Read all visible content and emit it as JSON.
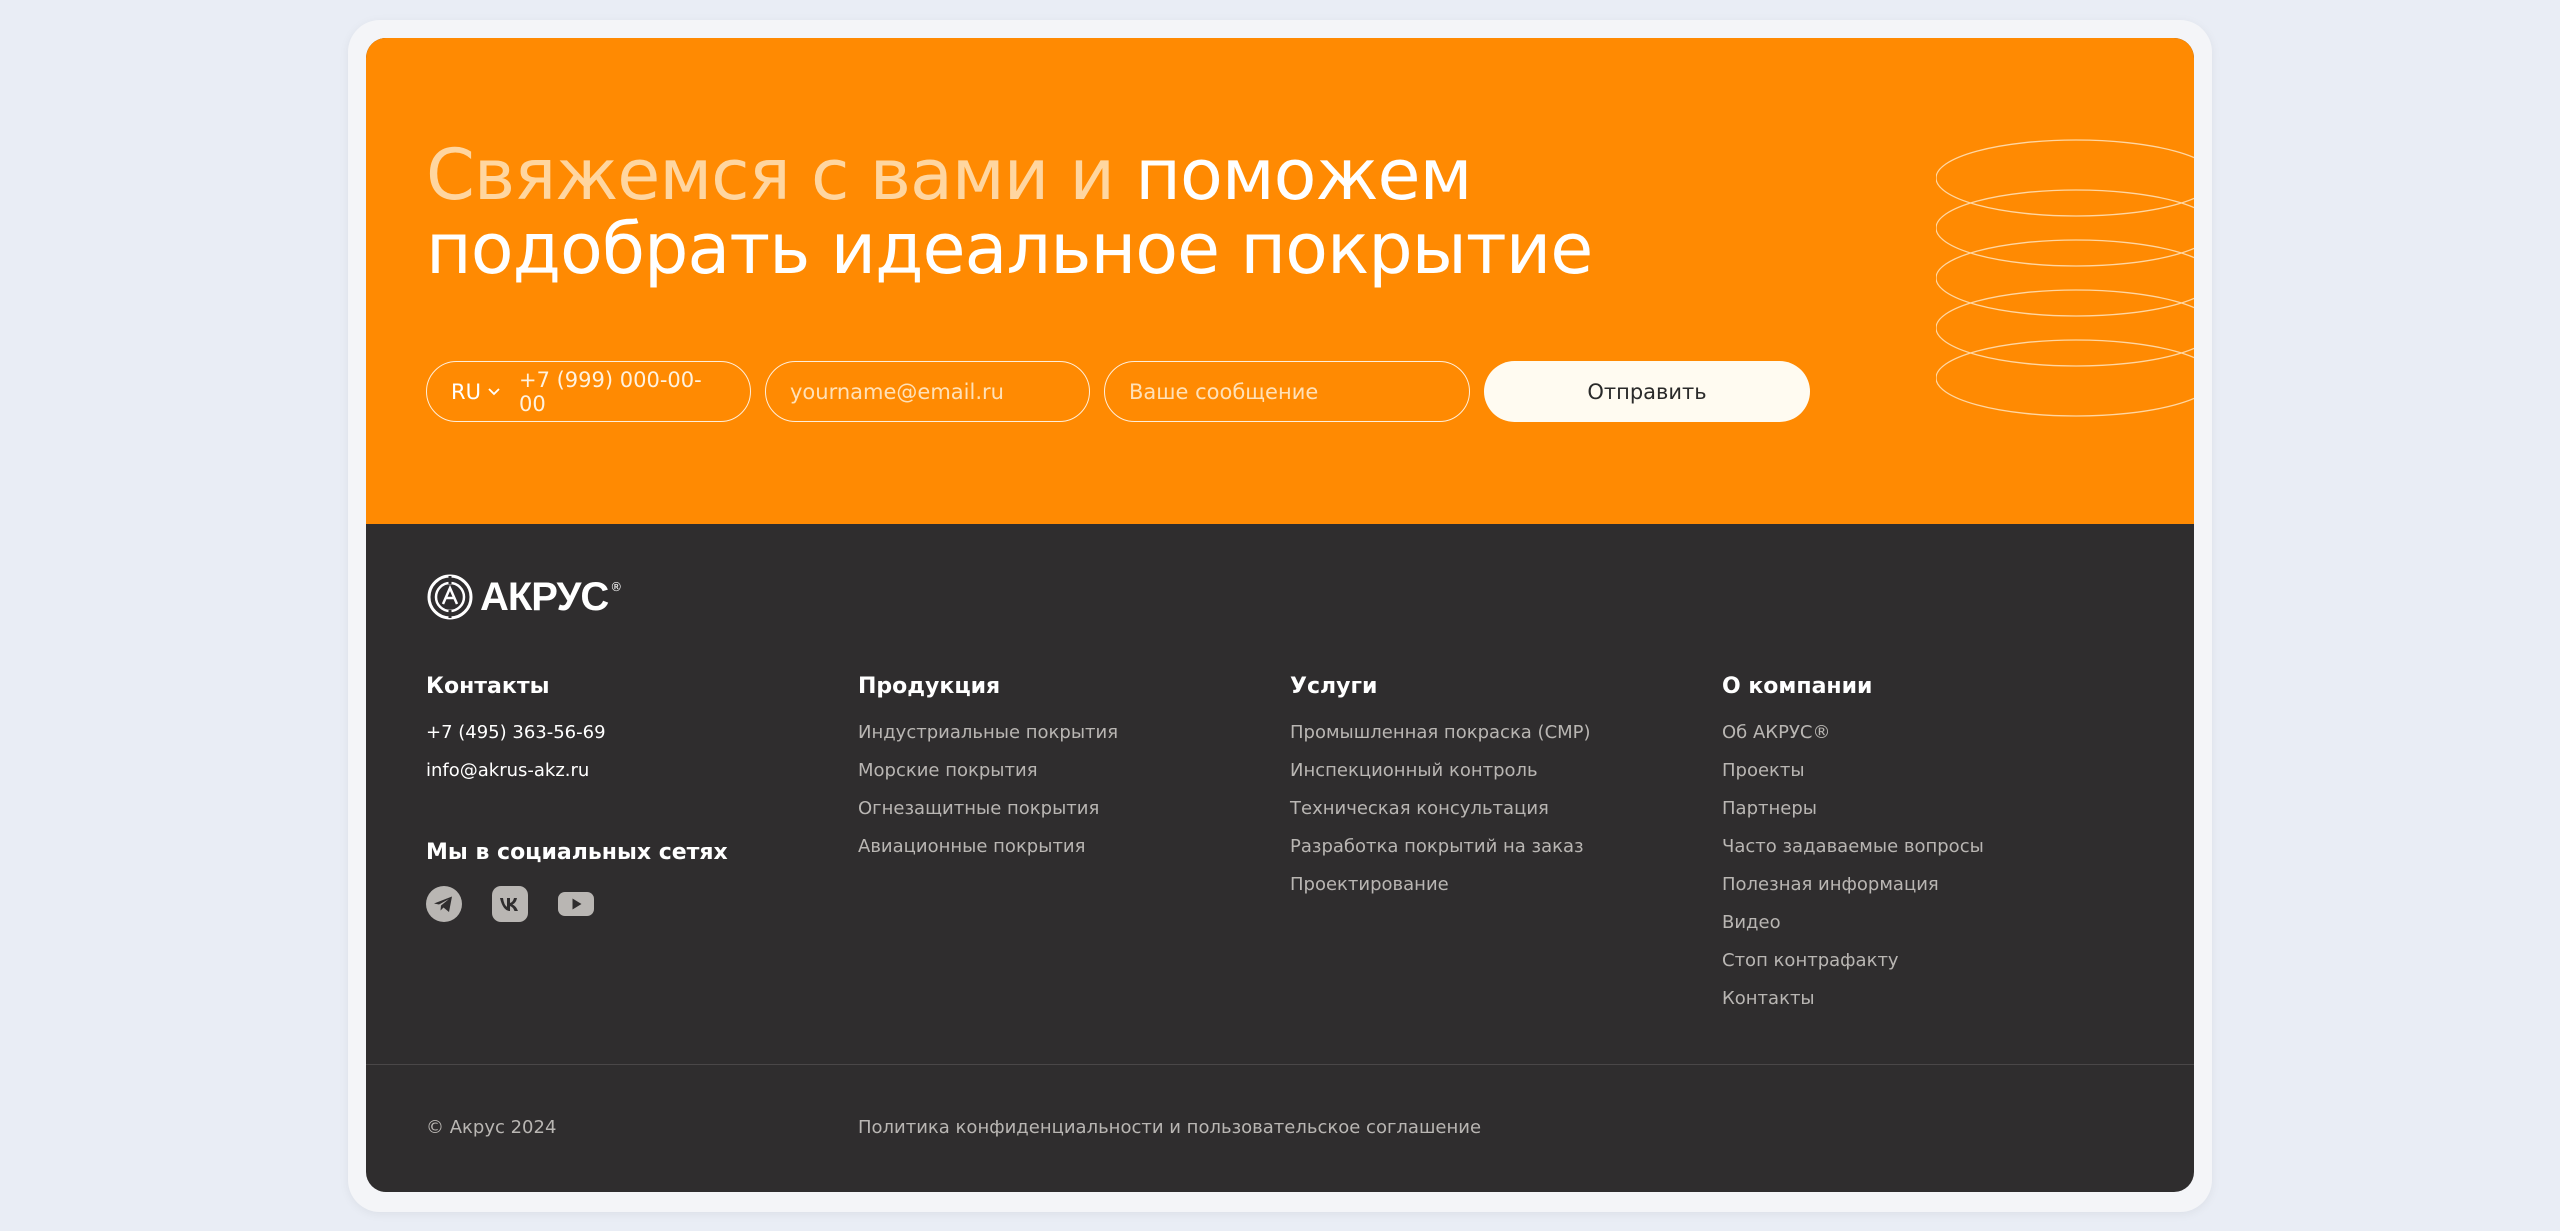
{
  "hero": {
    "title_muted": "Свяжемся с вами и",
    "title_main_1": "поможем",
    "title_main_2": "подобрать идеальное покрытие"
  },
  "form": {
    "country": "RU",
    "phone_placeholder": "+7 (999) 000-00-00",
    "email_placeholder": "yourname@email.ru",
    "message_placeholder": "Ваше сообщение",
    "submit_label": "Отправить"
  },
  "footer": {
    "logo_text": "АКРУС",
    "logo_reg": "®",
    "columns": [
      {
        "title": "Контакты",
        "items": [
          "+7 (495) 363-56-69",
          "info@akrus-akz.ru"
        ]
      },
      {
        "title": "Продукция",
        "items": [
          "Индустриальные покрытия",
          "Морские покрытия",
          "Огнезащитные покрытия",
          "Авиационные покрытия"
        ]
      },
      {
        "title": "Услуги",
        "items": [
          "Промышленная покраска (СМР)",
          "Инспекционный контроль",
          "Техническая консультация",
          "Разработка покрытий на заказ",
          "Проектирование"
        ]
      },
      {
        "title": "О компании",
        "items": [
          "Об АКРУС®",
          "Проекты",
          "Партнеры",
          "Часто задаваемые вопросы",
          "Полезная информация",
          "Видео",
          "Стоп контрафакту",
          "Контакты"
        ]
      }
    ],
    "social_title": "Мы в социальных сетях",
    "socials": [
      "telegram-icon",
      "vk-icon",
      "youtube-icon"
    ],
    "copyright": "© Акрус 2024",
    "policy": "Политика конфиденциальности и пользовательское соглашение"
  },
  "colors": {
    "accent": "#ff8a02",
    "footer_bg": "#2f2d2e",
    "page_bg": "#e9edf5"
  }
}
